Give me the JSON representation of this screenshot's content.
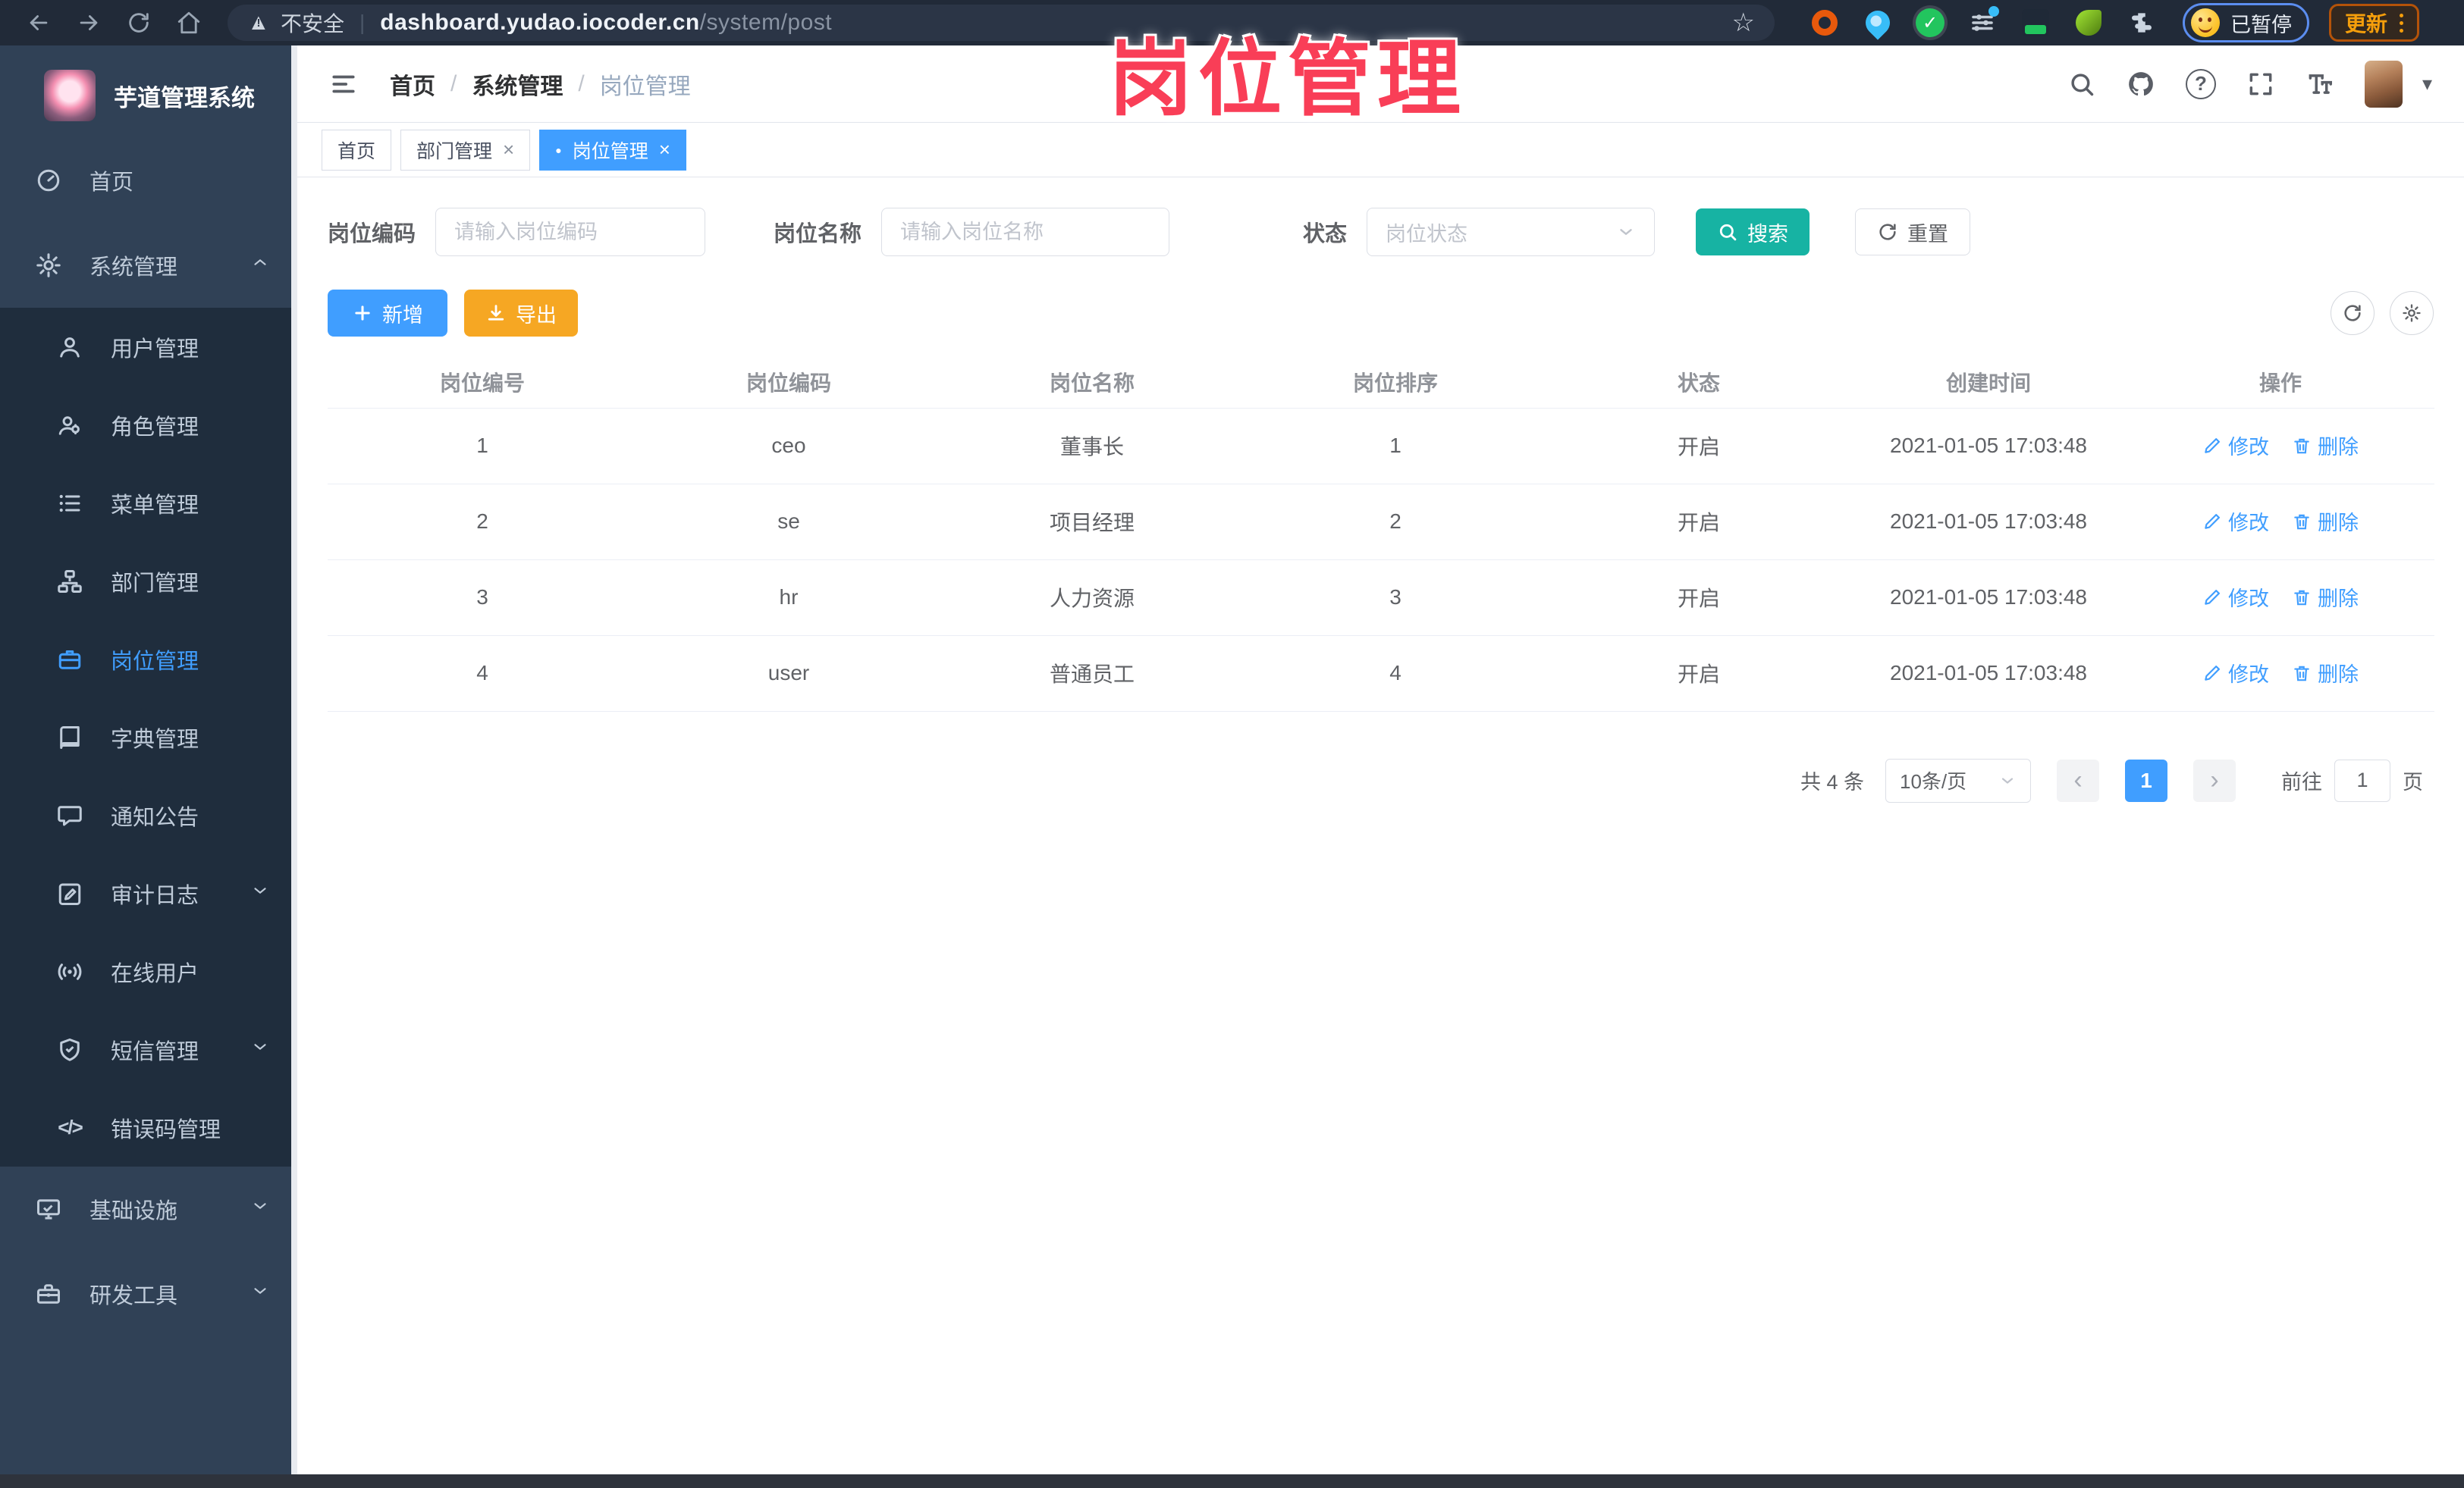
{
  "browser": {
    "security_label": "不安全",
    "url_domain": "dashboard.yudao.iocoder.cn",
    "url_path": "/system/post",
    "paused_label": "已暂停",
    "update_label": "更新"
  },
  "overlay_title": "岗位管理",
  "icons": {
    "close": "×",
    "dot": "●",
    "caret_down": "▾",
    "star": "☆",
    "warning_triangle": "▲",
    "bang": "!",
    "check": "✓",
    "question": "?",
    "prev": "‹",
    "next": "›",
    "code_glyph": "</>",
    "url_divider": "|"
  },
  "colors": {
    "accent": "#409eff",
    "search_button": "#17b3a3",
    "export_button": "#f6a723",
    "overlay_title": "#f93e57",
    "sidebar_bg": "#304156",
    "submenu_bg": "#1f2d3d"
  },
  "sidebar": {
    "brand": "芋道管理系统",
    "items": [
      {
        "label": "首页",
        "icon": "home-icon",
        "level": 1
      },
      {
        "label": "系统管理",
        "icon": "gear-icon",
        "level": 1,
        "chevron": "up"
      },
      {
        "label": "用户管理",
        "icon": "user-icon",
        "level": 2
      },
      {
        "label": "角色管理",
        "icon": "role-icon",
        "level": 2
      },
      {
        "label": "菜单管理",
        "icon": "menu-list-icon",
        "level": 2
      },
      {
        "label": "部门管理",
        "icon": "dept-tree-icon",
        "level": 2
      },
      {
        "label": "岗位管理",
        "icon": "briefcase-icon",
        "level": 2,
        "active": true
      },
      {
        "label": "字典管理",
        "icon": "book-icon",
        "level": 2
      },
      {
        "label": "通知公告",
        "icon": "message-icon",
        "level": 2
      },
      {
        "label": "审计日志",
        "icon": "audit-icon",
        "level": 2,
        "chevron": "down"
      },
      {
        "label": "在线用户",
        "icon": "online-icon",
        "level": 2
      },
      {
        "label": "短信管理",
        "icon": "shield-icon",
        "level": 2,
        "chevron": "down"
      },
      {
        "label": "错误码管理",
        "icon": "code-icon",
        "level": 2
      },
      {
        "label": "基础设施",
        "icon": "monitor-icon",
        "level": 1,
        "chevron": "down"
      },
      {
        "label": "研发工具",
        "icon": "toolbox-icon",
        "level": 1,
        "chevron": "down"
      }
    ]
  },
  "navbar": {
    "breadcrumb": [
      "首页",
      "系统管理",
      "岗位管理"
    ],
    "separator": "/"
  },
  "tabs": [
    {
      "label": "首页",
      "closable": false,
      "active": false
    },
    {
      "label": "部门管理",
      "closable": true,
      "active": false
    },
    {
      "label": "岗位管理",
      "closable": true,
      "active": true
    }
  ],
  "filter": {
    "code_label": "岗位编码",
    "code_placeholder": "请输入岗位编码",
    "name_label": "岗位名称",
    "name_placeholder": "请输入岗位名称",
    "status_label": "状态",
    "status_placeholder": "岗位状态",
    "search_label": "搜索",
    "reset_label": "重置"
  },
  "toolbar": {
    "add_label": "新增",
    "export_label": "导出"
  },
  "table": {
    "columns": [
      "岗位编号",
      "岗位编码",
      "岗位名称",
      "岗位排序",
      "状态",
      "创建时间",
      "操作"
    ],
    "rows": [
      {
        "id": "1",
        "code": "ceo",
        "name": "董事长",
        "sort": "1",
        "status": "开启",
        "created": "2021-01-05 17:03:48"
      },
      {
        "id": "2",
        "code": "se",
        "name": "项目经理",
        "sort": "2",
        "status": "开启",
        "created": "2021-01-05 17:03:48"
      },
      {
        "id": "3",
        "code": "hr",
        "name": "人力资源",
        "sort": "3",
        "status": "开启",
        "created": "2021-01-05 17:03:48"
      },
      {
        "id": "4",
        "code": "user",
        "name": "普通员工",
        "sort": "4",
        "status": "开启",
        "created": "2021-01-05 17:03:48"
      }
    ],
    "actions": {
      "edit": "修改",
      "delete": "删除"
    }
  },
  "pagination": {
    "total_label": "共 4 条",
    "page_size_label": "10条/页",
    "current_page": "1",
    "goto_label": "前往",
    "goto_value": "1",
    "page_suffix": "页"
  }
}
